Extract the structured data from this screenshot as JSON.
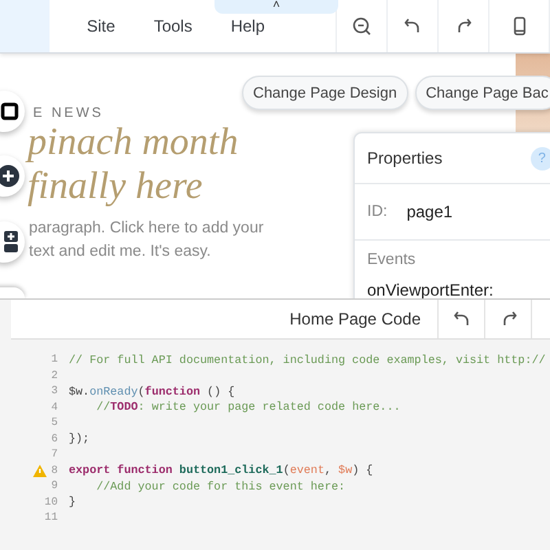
{
  "top_bar": {
    "menu": [
      "Site",
      "Tools",
      "Help"
    ],
    "collapse_tab": "˄"
  },
  "canvas": {
    "buttons": [
      "Change Page Design",
      "Change Page Bac"
    ],
    "kicker": "E NEWS",
    "headline": [
      "pinach month",
      "finally here"
    ],
    "paragraph": [
      "paragraph. Click here to add your",
      "text and edit me. It's easy."
    ]
  },
  "properties": {
    "title": "Properties",
    "help": "?",
    "id_label": "ID:",
    "id_value": "page1",
    "events_label": "Events",
    "event": "onViewportEnter:"
  },
  "code_panel": {
    "title": "Home Page Code",
    "lines": [
      {
        "number": "1",
        "warning": false,
        "tokens": [
          {
            "kind": "comment",
            "text": "// For full API documentation, including code examples, visit http://"
          }
        ]
      },
      {
        "number": "2",
        "warning": false
      },
      {
        "number": "3",
        "warning": false,
        "tokens": [
          {
            "kind": "plain",
            "text": "$w."
          },
          {
            "kind": "method",
            "text": "onReady"
          },
          {
            "kind": "plain",
            "text": "("
          },
          {
            "kind": "keyword",
            "text": "function"
          },
          {
            "kind": "plain",
            "text": " () {"
          }
        ]
      },
      {
        "number": "4",
        "warning": false,
        "tokens": [
          {
            "kind": "comment",
            "text": "    //"
          },
          {
            "kind": "todo",
            "text": "TODO"
          },
          {
            "kind": "comment",
            "text": ": write your page related code here..."
          }
        ]
      },
      {
        "number": "5",
        "warning": false
      },
      {
        "number": "6",
        "warning": false,
        "tokens": [
          {
            "kind": "plain",
            "text": "});"
          }
        ]
      },
      {
        "number": "7",
        "warning": false
      },
      {
        "number": "8",
        "warning": true,
        "tokens": [
          {
            "kind": "keyword",
            "text": "export function "
          },
          {
            "kind": "fn",
            "text": "button1_click_1"
          },
          {
            "kind": "plain",
            "text": "("
          },
          {
            "kind": "param",
            "text": "event"
          },
          {
            "kind": "plain",
            "text": ", "
          },
          {
            "kind": "param",
            "text": "$w"
          },
          {
            "kind": "plain",
            "text": ") {"
          }
        ]
      },
      {
        "number": "9",
        "warning": false,
        "tokens": [
          {
            "kind": "comment",
            "text": "    //Add your code for this event here:"
          }
        ]
      },
      {
        "number": "10",
        "warning": false,
        "tokens": [
          {
            "kind": "plain",
            "text": "}"
          }
        ]
      },
      {
        "number": "11",
        "warning": false
      }
    ]
  }
}
